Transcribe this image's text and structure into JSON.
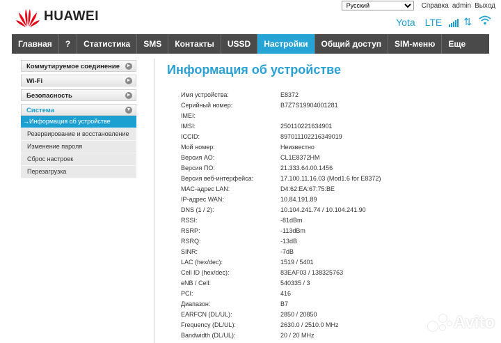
{
  "brand": {
    "name": "HUAWEI",
    "color": "#e60012"
  },
  "topbar": {
    "language_selected": "Русский",
    "language_options": [
      "Русский"
    ],
    "links": [
      "Справка",
      "admin",
      "Выход"
    ]
  },
  "status": {
    "carrier": "Yota",
    "network": "LTE",
    "signal_icon": "signal-bars-icon",
    "traffic_icon": "up-down-arrows-icon",
    "wifi_icon": "wifi-icon",
    "accent": "#1c9fd1"
  },
  "nav": {
    "items": [
      "Главная",
      "?",
      "Статистика",
      "SMS",
      "Контакты",
      "USSD",
      "Настройки",
      "Общий доступ",
      "SIM-меню",
      "Еще"
    ],
    "active": "Настройки",
    "bg_color": "#4a4a4a",
    "active_color": "#26a4d6"
  },
  "sidebar": {
    "sections": [
      "Коммутируемое соединение",
      "Wi-Fi",
      "Безопасность",
      "Система"
    ],
    "system_items": [
      "→Информация об устройстве",
      "Резервирование и восстановление",
      "Изменение пароля",
      "Сброс настроек",
      "Перезагрузка"
    ]
  },
  "main": {
    "title": "Информация об устройстве",
    "rows": [
      {
        "label": "Имя устройства:",
        "value": "E8372"
      },
      {
        "label": "Серийный номер:",
        "value": "B7Z7S19904001281"
      },
      {
        "label": "IMEI:",
        "value": ""
      },
      {
        "label": "IMSI:",
        "value": "250110221634901"
      },
      {
        "label": "ICCID:",
        "value": "897011102216349019"
      },
      {
        "label": "Мой номер:",
        "value": "Неизвестно"
      },
      {
        "label": "Версия АО:",
        "value": "CL1E8372HM"
      },
      {
        "label": "Версия ПО:",
        "value": "21.333.64.00.1456"
      },
      {
        "label": "Версия веб-интерфейса:",
        "value": "17.100.11.16.03 (Mod1.6 for E8372)"
      },
      {
        "label": "MAC-адрес LAN:",
        "value": "D4:62:EA:67:75:BE"
      },
      {
        "label": "IP-адрес WAN:",
        "value": "10.84.191.89"
      },
      {
        "label": "DNS (1 / 2):",
        "value": "10.104.241.74 / 10.104.241.90"
      },
      {
        "label": "RSSI:",
        "value": "-81dBm"
      },
      {
        "label": "RSRP:",
        "value": "-113dBm"
      },
      {
        "label": "RSRQ:",
        "value": "-13dB"
      },
      {
        "label": "SINR:",
        "value": "-7dB"
      },
      {
        "label": "LAC (hex/dec):",
        "value": "1519 / 5401"
      },
      {
        "label": "Cell ID (hex/dec):",
        "value": "83EAF03 / 138325763"
      },
      {
        "label": "eNB / Cell:",
        "value": "540335 / 3"
      },
      {
        "label": "PCI:",
        "value": "416"
      },
      {
        "label": "Диапазон:",
        "value": "B7"
      },
      {
        "label": "EARFCN (DL/UL):",
        "value": "2850 / 20850"
      },
      {
        "label": "Frequency (DL/UL):",
        "value": "2630.0 / 2510.0 MHz"
      },
      {
        "label": "Bandwidth (DL/UL):",
        "value": "20 / 20 MHz"
      }
    ]
  },
  "watermark": {
    "text": "Avito"
  }
}
